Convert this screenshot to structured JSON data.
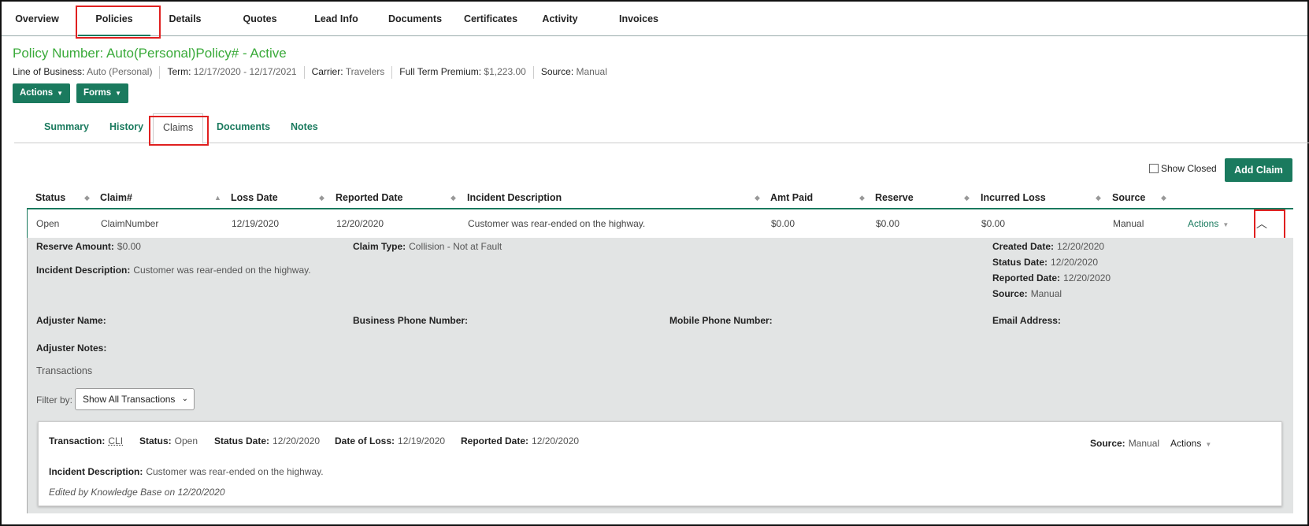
{
  "topnav": {
    "tabs": [
      "Overview",
      "Policies",
      "Details",
      "Quotes",
      "Lead Info",
      "Documents",
      "Certificates",
      "Activity",
      "Invoices"
    ],
    "active": "Policies"
  },
  "policy": {
    "title": "Policy Number: Auto(Personal)Policy# - Active",
    "lob_label": "Line of Business:",
    "lob": "Auto (Personal)",
    "term_label": "Term:",
    "term": "12/17/2020 - 12/17/2021",
    "carrier_label": "Carrier:",
    "carrier": "Travelers",
    "premium_label": "Full Term Premium:",
    "premium": "$1,223.00",
    "source_label": "Source:",
    "source": "Manual"
  },
  "buttons": {
    "actions": "Actions",
    "forms": "Forms"
  },
  "subtabs": [
    "Summary",
    "History",
    "Claims",
    "Documents",
    "Notes"
  ],
  "claims_toolbar": {
    "show_closed": "Show Closed",
    "add_claim": "Add Claim"
  },
  "table": {
    "headers": [
      "Status",
      "Claim#",
      "Loss Date",
      "Reported Date",
      "Incident Description",
      "Amt Paid",
      "Reserve",
      "Incurred Loss",
      "Source"
    ],
    "row": {
      "status": "Open",
      "claim": "ClaimNumber",
      "loss_date": "12/19/2020",
      "reported_date": "12/20/2020",
      "description": "Customer was rear-ended on the highway.",
      "amt_paid": "$0.00",
      "reserve": "$0.00",
      "incurred_loss": "$0.00",
      "source": "Manual",
      "actions": "Actions"
    }
  },
  "detail": {
    "reserve_amount_label": "Reserve Amount:",
    "reserve_amount": "$0.00",
    "claim_type_label": "Claim Type:",
    "claim_type": "Collision - Not at Fault",
    "created_date_label": "Created Date:",
    "created_date": "12/20/2020",
    "status_date_label": "Status Date:",
    "status_date": "12/20/2020",
    "reported_date_label": "Reported Date:",
    "reported_date": "12/20/2020",
    "source_label": "Source:",
    "source": "Manual",
    "incident_label": "Incident Description:",
    "incident": "Customer was rear-ended on the highway.",
    "adjuster_name_label": "Adjuster Name:",
    "business_phone_label": "Business Phone Number:",
    "mobile_phone_label": "Mobile Phone Number:",
    "email_label": "Email Address:",
    "adjuster_notes_label": "Adjuster Notes:",
    "transactions_title": "Transactions",
    "filter_label": "Filter by:",
    "filter_value": "Show All Transactions"
  },
  "transaction": {
    "transaction_label": "Transaction:",
    "transaction": "CLI",
    "status_label": "Status:",
    "status": "Open",
    "status_date_label": "Status Date:",
    "status_date": "12/20/2020",
    "loss_label": "Date of Loss:",
    "loss": "12/19/2020",
    "reported_label": "Reported Date:",
    "reported": "12/20/2020",
    "source_label": "Source:",
    "source": "Manual",
    "actions": "Actions",
    "incident_label": "Incident Description:",
    "incident": "Customer was rear-ended on the highway.",
    "edited": "Edited by Knowledge Base on 12/20/2020"
  }
}
